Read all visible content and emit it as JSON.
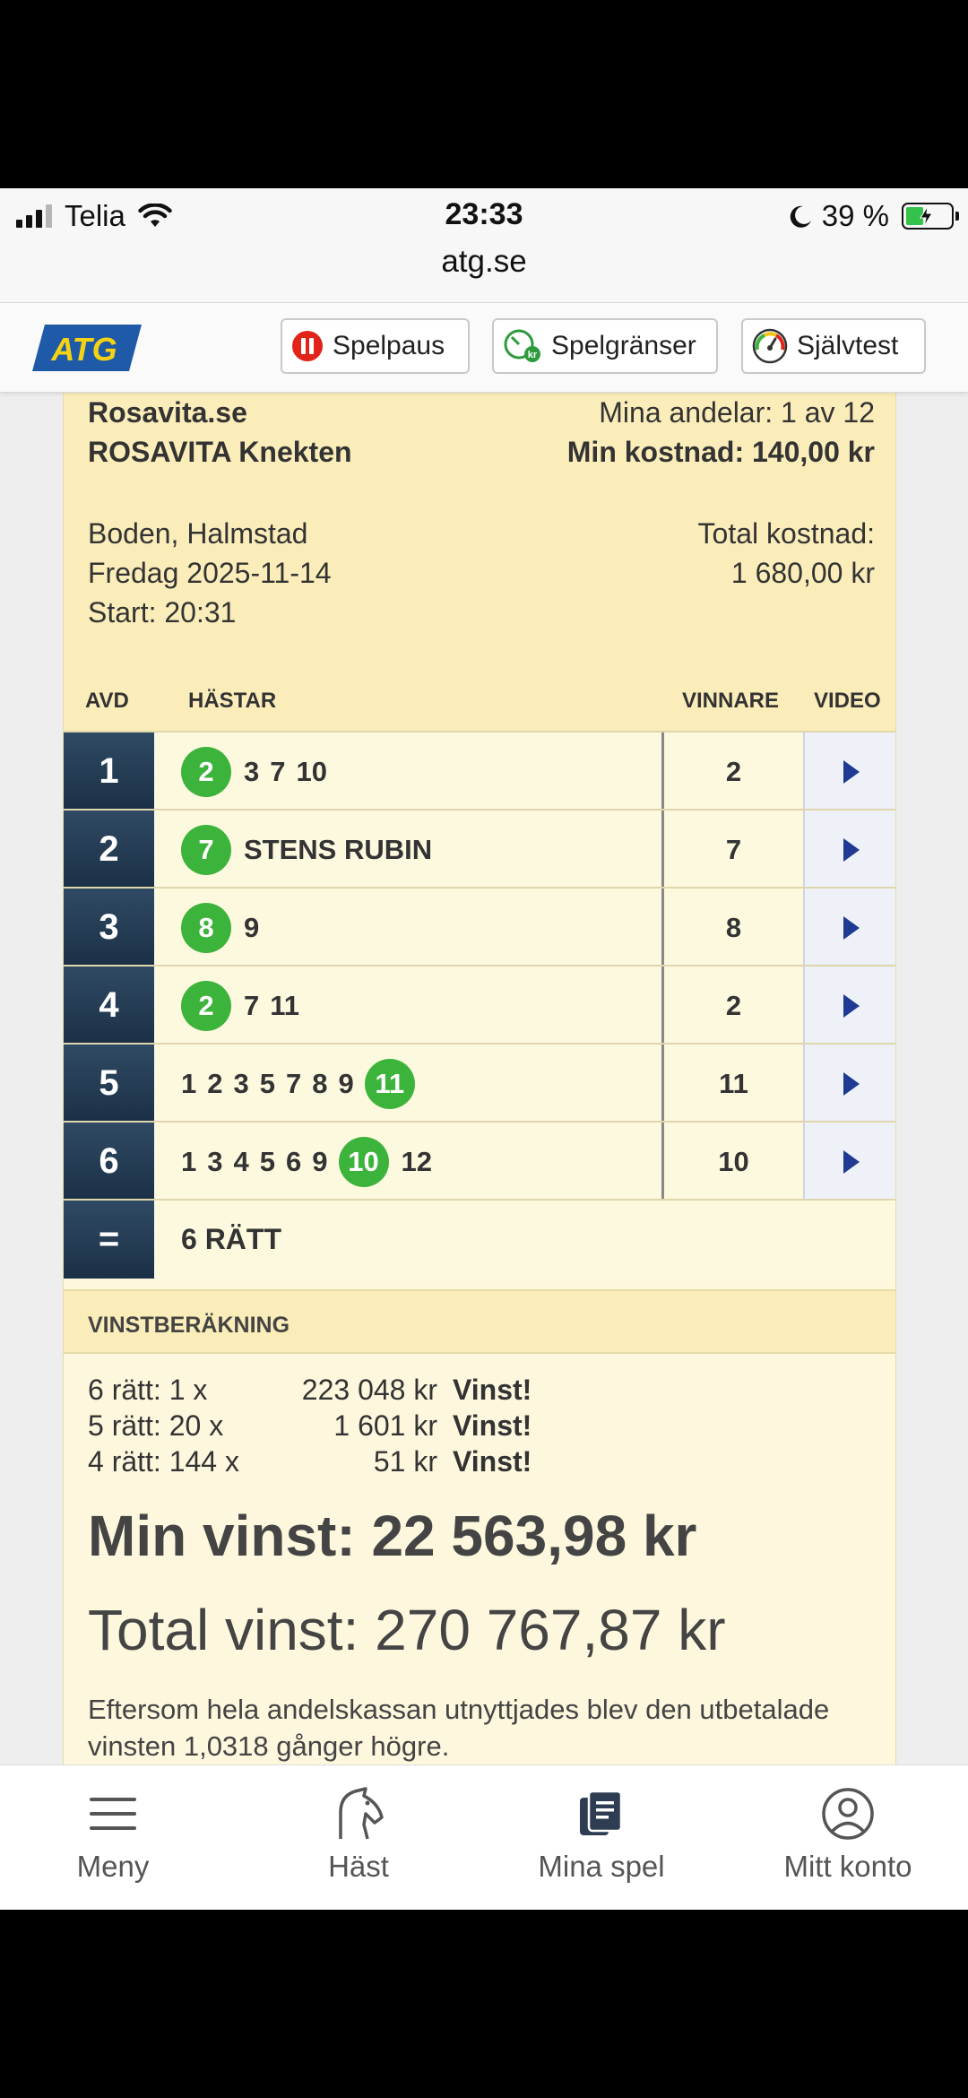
{
  "status_bar": {
    "carrier": "Telia",
    "time": "23:33",
    "battery": "39 %",
    "url": "atg.se",
    "icons": [
      "signal-icon",
      "wifi-icon",
      "moon-icon",
      "battery-charging-icon"
    ]
  },
  "top_nav": {
    "logo": "ATG",
    "buttons": [
      {
        "label": "Spelpaus",
        "icon": "pause-icon"
      },
      {
        "label": "Spelgränser",
        "icon": "limits-icon"
      },
      {
        "label": "Självtest",
        "icon": "gauge-icon"
      }
    ]
  },
  "game": {
    "site": "Rosavita.se",
    "team": "ROSAVITA Knekten",
    "shares": "Mina andelar: 1 av 12",
    "my_cost": "Min kostnad: 140,00 kr",
    "tracks": "Boden, Halmstad",
    "date": "Fredag 2025-11-14",
    "start": "Start: 20:31",
    "total_cost_label": "Total kostnad:",
    "total_cost_value": "1 680,00 kr"
  },
  "table": {
    "headers": {
      "avd": "AVD",
      "horses": "HÄSTAR",
      "winner": "VINNARE",
      "video": "VIDEO"
    },
    "rows": [
      {
        "avd": "1",
        "horses": [
          "2",
          "3",
          "7",
          "10"
        ],
        "winner": "2",
        "name": ""
      },
      {
        "avd": "2",
        "horses": [
          "7"
        ],
        "winner": "7",
        "name": "STENS RUBIN"
      },
      {
        "avd": "3",
        "horses": [
          "8",
          "9"
        ],
        "winner": "8",
        "name": ""
      },
      {
        "avd": "4",
        "horses": [
          "2",
          "7",
          "11"
        ],
        "winner": "2",
        "name": ""
      },
      {
        "avd": "5",
        "horses": [
          "1",
          "2",
          "3",
          "5",
          "7",
          "8",
          "9",
          "11"
        ],
        "winner": "11",
        "name": ""
      },
      {
        "avd": "6",
        "horses": [
          "1",
          "3",
          "4",
          "5",
          "6",
          "9",
          "10",
          "12"
        ],
        "winner": "10",
        "name": ""
      }
    ],
    "sum_symbol": "=",
    "sum_label": "6 RÄTT"
  },
  "vinstberakning": {
    "title": "VINSTBERÄKNING",
    "lines": [
      {
        "count": "6 rätt: 1 x",
        "amount": "223 048 kr",
        "status": "Vinst!"
      },
      {
        "count": "5 rätt: 20 x",
        "amount": "1 601 kr",
        "status": "Vinst!"
      },
      {
        "count": "4 rätt: 144 x",
        "amount": "51 kr",
        "status": "Vinst!"
      }
    ],
    "my_win": "Min vinst: 22 563,98 kr",
    "total_win": "Total vinst: 270 767,87 kr",
    "note": "Eftersom hela andelskassan utnyttjades blev den utbetalade vinsten 1,0318 gånger högre."
  },
  "tab_bar": [
    {
      "label": "Meny",
      "icon": "menu-icon"
    },
    {
      "label": "Häst",
      "icon": "horse-icon"
    },
    {
      "label": "Mina spel",
      "icon": "coupons-icon"
    },
    {
      "label": "Mitt konto",
      "icon": "account-icon"
    }
  ],
  "colors": {
    "winner_green": "#3cb43c",
    "avd_navy": "#243b53",
    "card_bg": "#fdf7dd",
    "header_bg": "#fbedb9",
    "play_blue": "#1f3a93"
  }
}
